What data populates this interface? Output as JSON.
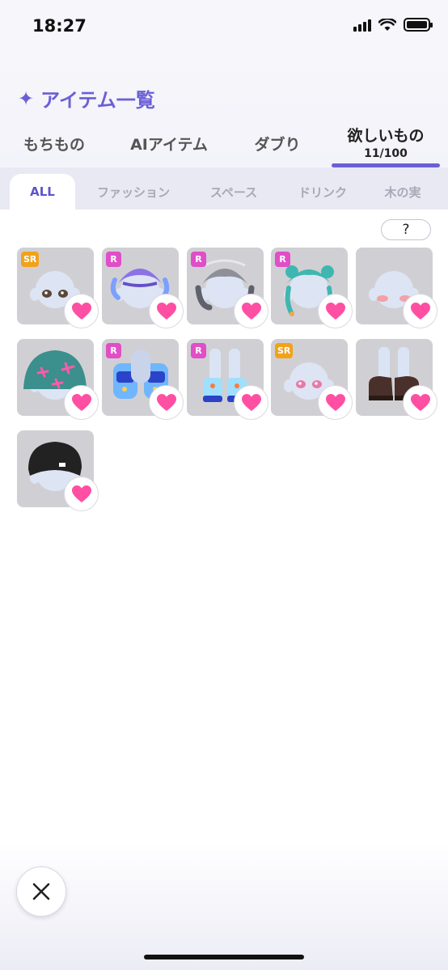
{
  "status_bar": {
    "time": "18:27"
  },
  "header": {
    "title": "アイテム一覧"
  },
  "main_tabs": [
    {
      "label": "もちもの"
    },
    {
      "label": "AIアイテム"
    },
    {
      "label": "ダブり"
    },
    {
      "label": "欲しいもの",
      "count": "11/100",
      "active": true
    }
  ],
  "sub_tabs": [
    {
      "label": "ALL",
      "active": true
    },
    {
      "label": "ファッション"
    },
    {
      "label": "スペース"
    },
    {
      "label": "ドリンク"
    },
    {
      "label": "木の実"
    }
  ],
  "help": {
    "label": "?"
  },
  "items": [
    {
      "rarity": "SR",
      "kind": "eyes-brown"
    },
    {
      "rarity": "R",
      "kind": "hair-purple"
    },
    {
      "rarity": "R",
      "kind": "hair-silver"
    },
    {
      "rarity": "R",
      "kind": "hair-teal-braids"
    },
    {
      "rarity": "",
      "kind": "blush"
    },
    {
      "rarity": "",
      "kind": "hat-cactus"
    },
    {
      "rarity": "R",
      "kind": "outfit-aquarium"
    },
    {
      "rarity": "R",
      "kind": "shoes-aquarium"
    },
    {
      "rarity": "SR",
      "kind": "eyes-pink"
    },
    {
      "rarity": "",
      "kind": "shoes-brown"
    },
    {
      "rarity": "",
      "kind": "beanie-black"
    }
  ],
  "colors": {
    "accent": "#6b5fd6",
    "heart": "#ff4fa3",
    "rarity_r": "#e04ec8",
    "rarity_sr": "#f1a21a",
    "card_bg": "#d0d0d4"
  }
}
